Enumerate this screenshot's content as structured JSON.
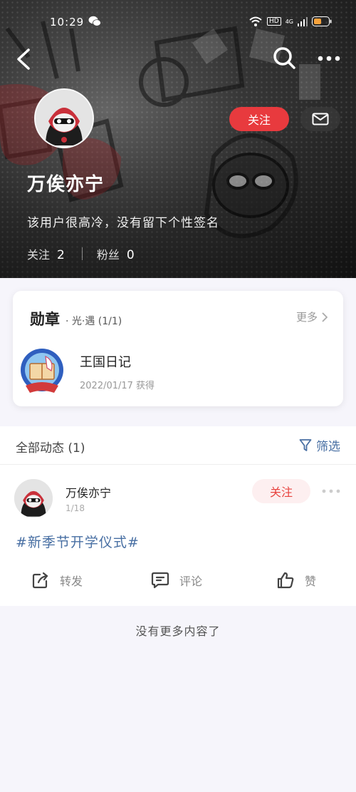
{
  "status_bar": {
    "time": "10:29",
    "hd": "HD",
    "network": "4G"
  },
  "profile": {
    "username": "万俟亦宁",
    "signature": "该用户很高冷，没有留下个性签名",
    "follow_label": "关注",
    "following_label": "关注",
    "following_count": "2",
    "fans_label": "粉丝",
    "fans_count": "0"
  },
  "badges": {
    "title": "勋章",
    "subtitle": "· 光·遇  (1/1)",
    "more_label": "更多",
    "item": {
      "name": "王国日记",
      "date": "2022/01/17 获得"
    }
  },
  "feed": {
    "count_label": "全部动态 (1)",
    "filter_label": "筛选",
    "post": {
      "author": "万俟亦宁",
      "date": "1/18",
      "follow_label": "关注",
      "topic": "#新季节开学仪式#",
      "actions": {
        "share": "转发",
        "comment": "评论",
        "like": "赞"
      }
    }
  },
  "footer": {
    "no_more": "没有更多内容了"
  },
  "colors": {
    "accent_red": "#e83a3e",
    "link_blue": "#486fa3",
    "page_bg": "#f6f5fb"
  }
}
